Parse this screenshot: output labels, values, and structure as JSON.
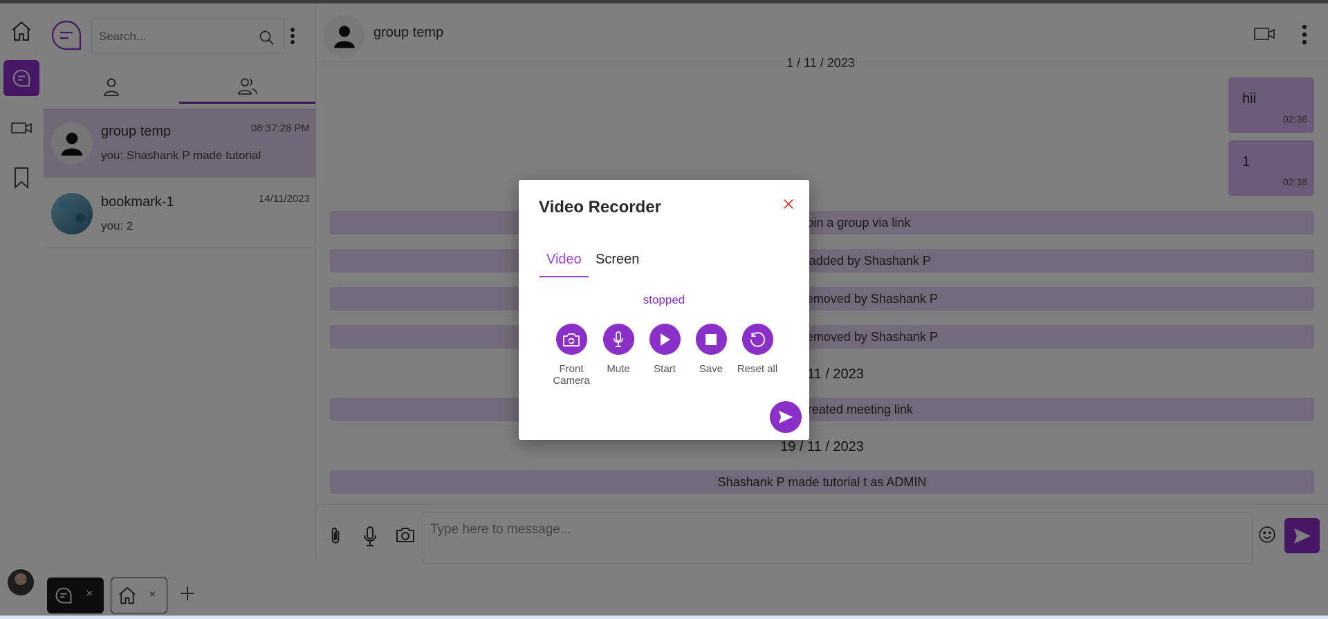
{
  "search": {
    "placeholder": "Search..."
  },
  "chat_list": [
    {
      "name": "group temp",
      "time": "08:37:28 PM",
      "last": "you: Shashank P made tutorial"
    },
    {
      "name": "bookmark-1",
      "time": "14/11/2023",
      "last": "you: 2"
    }
  ],
  "conversation": {
    "title": "group temp",
    "date_cut": "1 / 11 / 2023",
    "messages": [
      {
        "text": "hii",
        "time": "02:36"
      },
      {
        "text": "1",
        "time": "02:38"
      }
    ],
    "system": [
      "Shashank P join a group via link",
      "Shashank P was added by Shashank P",
      "Shashank P was removed by Shashank P",
      "Shashank P was removed by Shashank P",
      "Shashank P created meeting link",
      "Shashank P made tutorial t as ADMIN"
    ],
    "dates": [
      "18 / 11 / 2023",
      "19 / 11 / 2023"
    ],
    "composer_placeholder": "Type here to message..."
  },
  "modal": {
    "title": "Video Recorder",
    "tabs": [
      "Video",
      "Screen"
    ],
    "status": "stopped",
    "controls": [
      "Front Camera",
      "Mute",
      "Start",
      "Save",
      "Reset all"
    ]
  },
  "dock": {
    "tab1_close": "×",
    "tab2_close": "×"
  },
  "colors": {
    "accent": "#8b2fc9",
    "bubble": "#d9b7f1",
    "system": "#e7d3f5",
    "close": "#e0342a"
  }
}
